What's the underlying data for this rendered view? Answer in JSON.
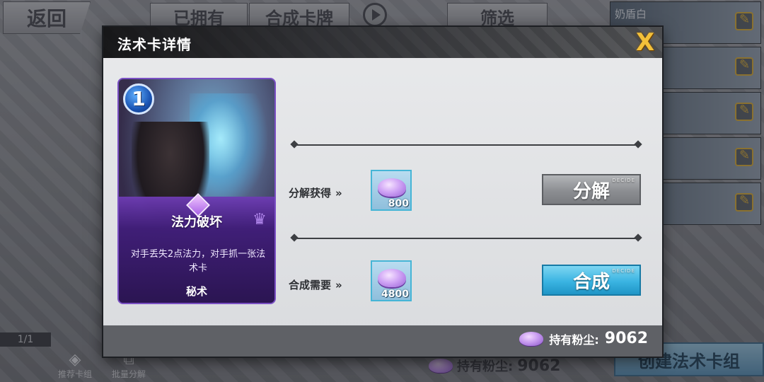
{
  "background": {
    "back_label": "返回",
    "tab_owned": "已拥有",
    "tab_craft": "合成卡牌",
    "filter_label": "筛选",
    "deck_list": [
      {
        "name": "奶盾白"
      },
      {
        "name": ""
      },
      {
        "name": ""
      },
      {
        "name": ""
      },
      {
        "name": ""
      }
    ],
    "page_indicator": "1/1",
    "recommended_deck_label": "推荐卡组",
    "batch_decompose_label": "批量分解",
    "dust_label": "持有粉尘:",
    "dust_value": "9062",
    "create_deck_label": "创建法术卡组"
  },
  "modal": {
    "title": "法术卡详情",
    "close_label": "X",
    "card": {
      "cost": "1",
      "name": "法力破坏",
      "description": "对手丢失2点法力，对手抓一张法术卡",
      "category": "秘术"
    },
    "decompose": {
      "label": "分解获得",
      "amount": "800",
      "button_label": "分解",
      "button_tag": "DECIDE"
    },
    "craft": {
      "label": "合成需要",
      "amount": "4800",
      "button_label": "合成",
      "button_tag": "DECIDE"
    },
    "footer": {
      "dust_label": "持有粉尘:",
      "dust_value": "9062"
    }
  },
  "colors": {
    "accent_close": "#f3c03a",
    "craft_button": "#3ab4e2",
    "decompose_button": "#8c8e92",
    "card_border": "#7a4fc4"
  }
}
